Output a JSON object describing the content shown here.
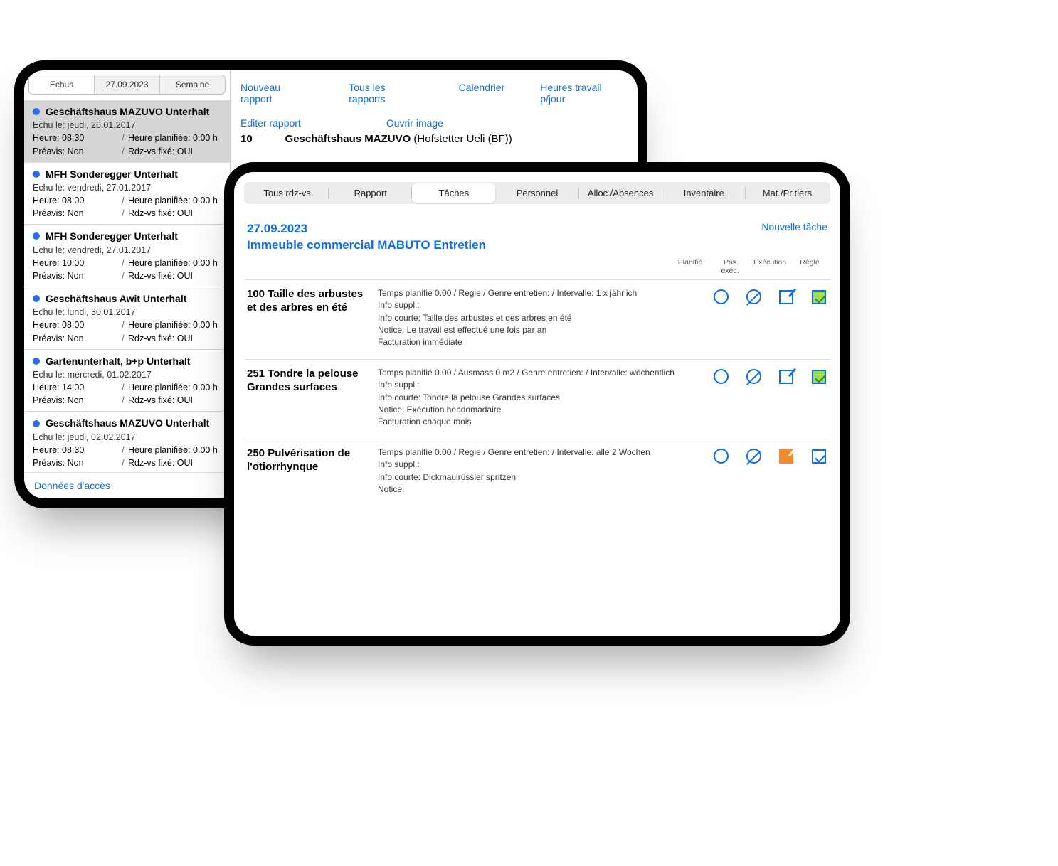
{
  "back": {
    "segments": [
      "Echus",
      "27.09.2023",
      "Semaine"
    ],
    "active_segment": 0,
    "toplinks": [
      "Nouveau rapport",
      "Tous les rapports",
      "Calendrier",
      "Heures travail p/jour"
    ],
    "rowlinks": [
      "Editer rapport",
      "Ouvrir image"
    ],
    "detail_id": "10",
    "detail_title_bold": "Geschäftshaus MAZUVO",
    "detail_title_rest": "(Hofstetter Ueli (BF))",
    "footer": "Données d'accès",
    "items": [
      {
        "title": "Geschäftshaus MAZUVO Unterhalt",
        "echu": "jeudi, 26.01.2017",
        "heure": "08:30",
        "planifiee": "0.00 h",
        "preavis": "Non",
        "rdz": "OUI",
        "selected": true
      },
      {
        "title": "MFH Sonderegger Unterhalt",
        "echu": "vendredi, 27.01.2017",
        "heure": "08:00",
        "planifiee": "0.00 h",
        "preavis": "Non",
        "rdz": "OUI",
        "selected": false
      },
      {
        "title": "MFH Sonderegger Unterhalt",
        "echu": "vendredi, 27.01.2017",
        "heure": "10:00",
        "planifiee": "0.00 h",
        "preavis": "Non",
        "rdz": "OUI",
        "selected": false
      },
      {
        "title": "Geschäftshaus Awit Unterhalt",
        "echu": "lundi, 30.01.2017",
        "heure": "08:00",
        "planifiee": "0.00 h",
        "preavis": "Non",
        "rdz": "OUI",
        "selected": false
      },
      {
        "title": "Gartenunterhalt, b+p Unterhalt",
        "echu": "mercredi, 01.02.2017",
        "heure": "14:00",
        "planifiee": "0.00 h",
        "preavis": "Non",
        "rdz": "OUI",
        "selected": false
      },
      {
        "title": "Geschäftshaus MAZUVO Unterhalt",
        "echu": "jeudi, 02.02.2017",
        "heure": "08:30",
        "planifiee": "0.00 h",
        "preavis": "Non",
        "rdz": "OUI",
        "selected": false
      }
    ],
    "labels": {
      "echu": "Echu le:",
      "heure": "Heure:",
      "plan": "Heure planifiée:",
      "preavis": "Préavis:",
      "rdz": "Rdz-vs fixé:"
    }
  },
  "front": {
    "tabs": [
      "Tous rdz-vs",
      "Rapport",
      "Tâches",
      "Personnel",
      "Alloc./Absences",
      "Inventaire",
      "Mat./Pr.tiers"
    ],
    "active_tab": 2,
    "date": "27.09.2023",
    "title": "Immeuble commercial MABUTO Entretien",
    "new_task": "Nouvelle tâche",
    "columns": [
      "Planifié",
      "Pas exéc.",
      "Exécution",
      "Réglé"
    ],
    "labels": {
      "temps": "Temps planifié",
      "regie": "Regie",
      "ausmass": "Ausmass",
      "genre": "Genre entretien:",
      "intervalle": "Intervalle:",
      "info": "Info suppl.:",
      "courte": "Info courte:",
      "notice": "Notice:"
    },
    "tasks": [
      {
        "title": "100 Taille des arbustes et des arbres en été",
        "meta": "Temps planifié 0.00 / Regie / Genre entretien:  / Intervalle: 1 x jährlich",
        "info_suppl": "",
        "info_courte": "Taille des arbustes et des arbres en été",
        "notice": "Le travail est effectué une fois par an",
        "billing": "Facturation immédiate",
        "exec": "blue",
        "regle": "green"
      },
      {
        "title": "251 Tondre la pelouse Grandes surfaces",
        "meta": "Temps planifié 0.00 / Ausmass 0 m2 / Genre entretien:  / Intervalle: wöchentlich",
        "info_suppl": "",
        "info_courte": "Tondre la pelouse Grandes surfaces",
        "notice": "Exécution hebdomadaire",
        "billing": "Facturation chaque mois",
        "exec": "blue",
        "regle": "green"
      },
      {
        "title": "250 Pulvérisation de l'otiorrhynque",
        "meta": "Temps planifié 0.00 / Regie / Genre entretien:  / Intervalle: alle 2 Wochen",
        "info_suppl": "",
        "info_courte": "Dickmaulrüssler spritzen",
        "notice": "",
        "billing": "",
        "exec": "orange",
        "regle": "blue"
      }
    ]
  }
}
